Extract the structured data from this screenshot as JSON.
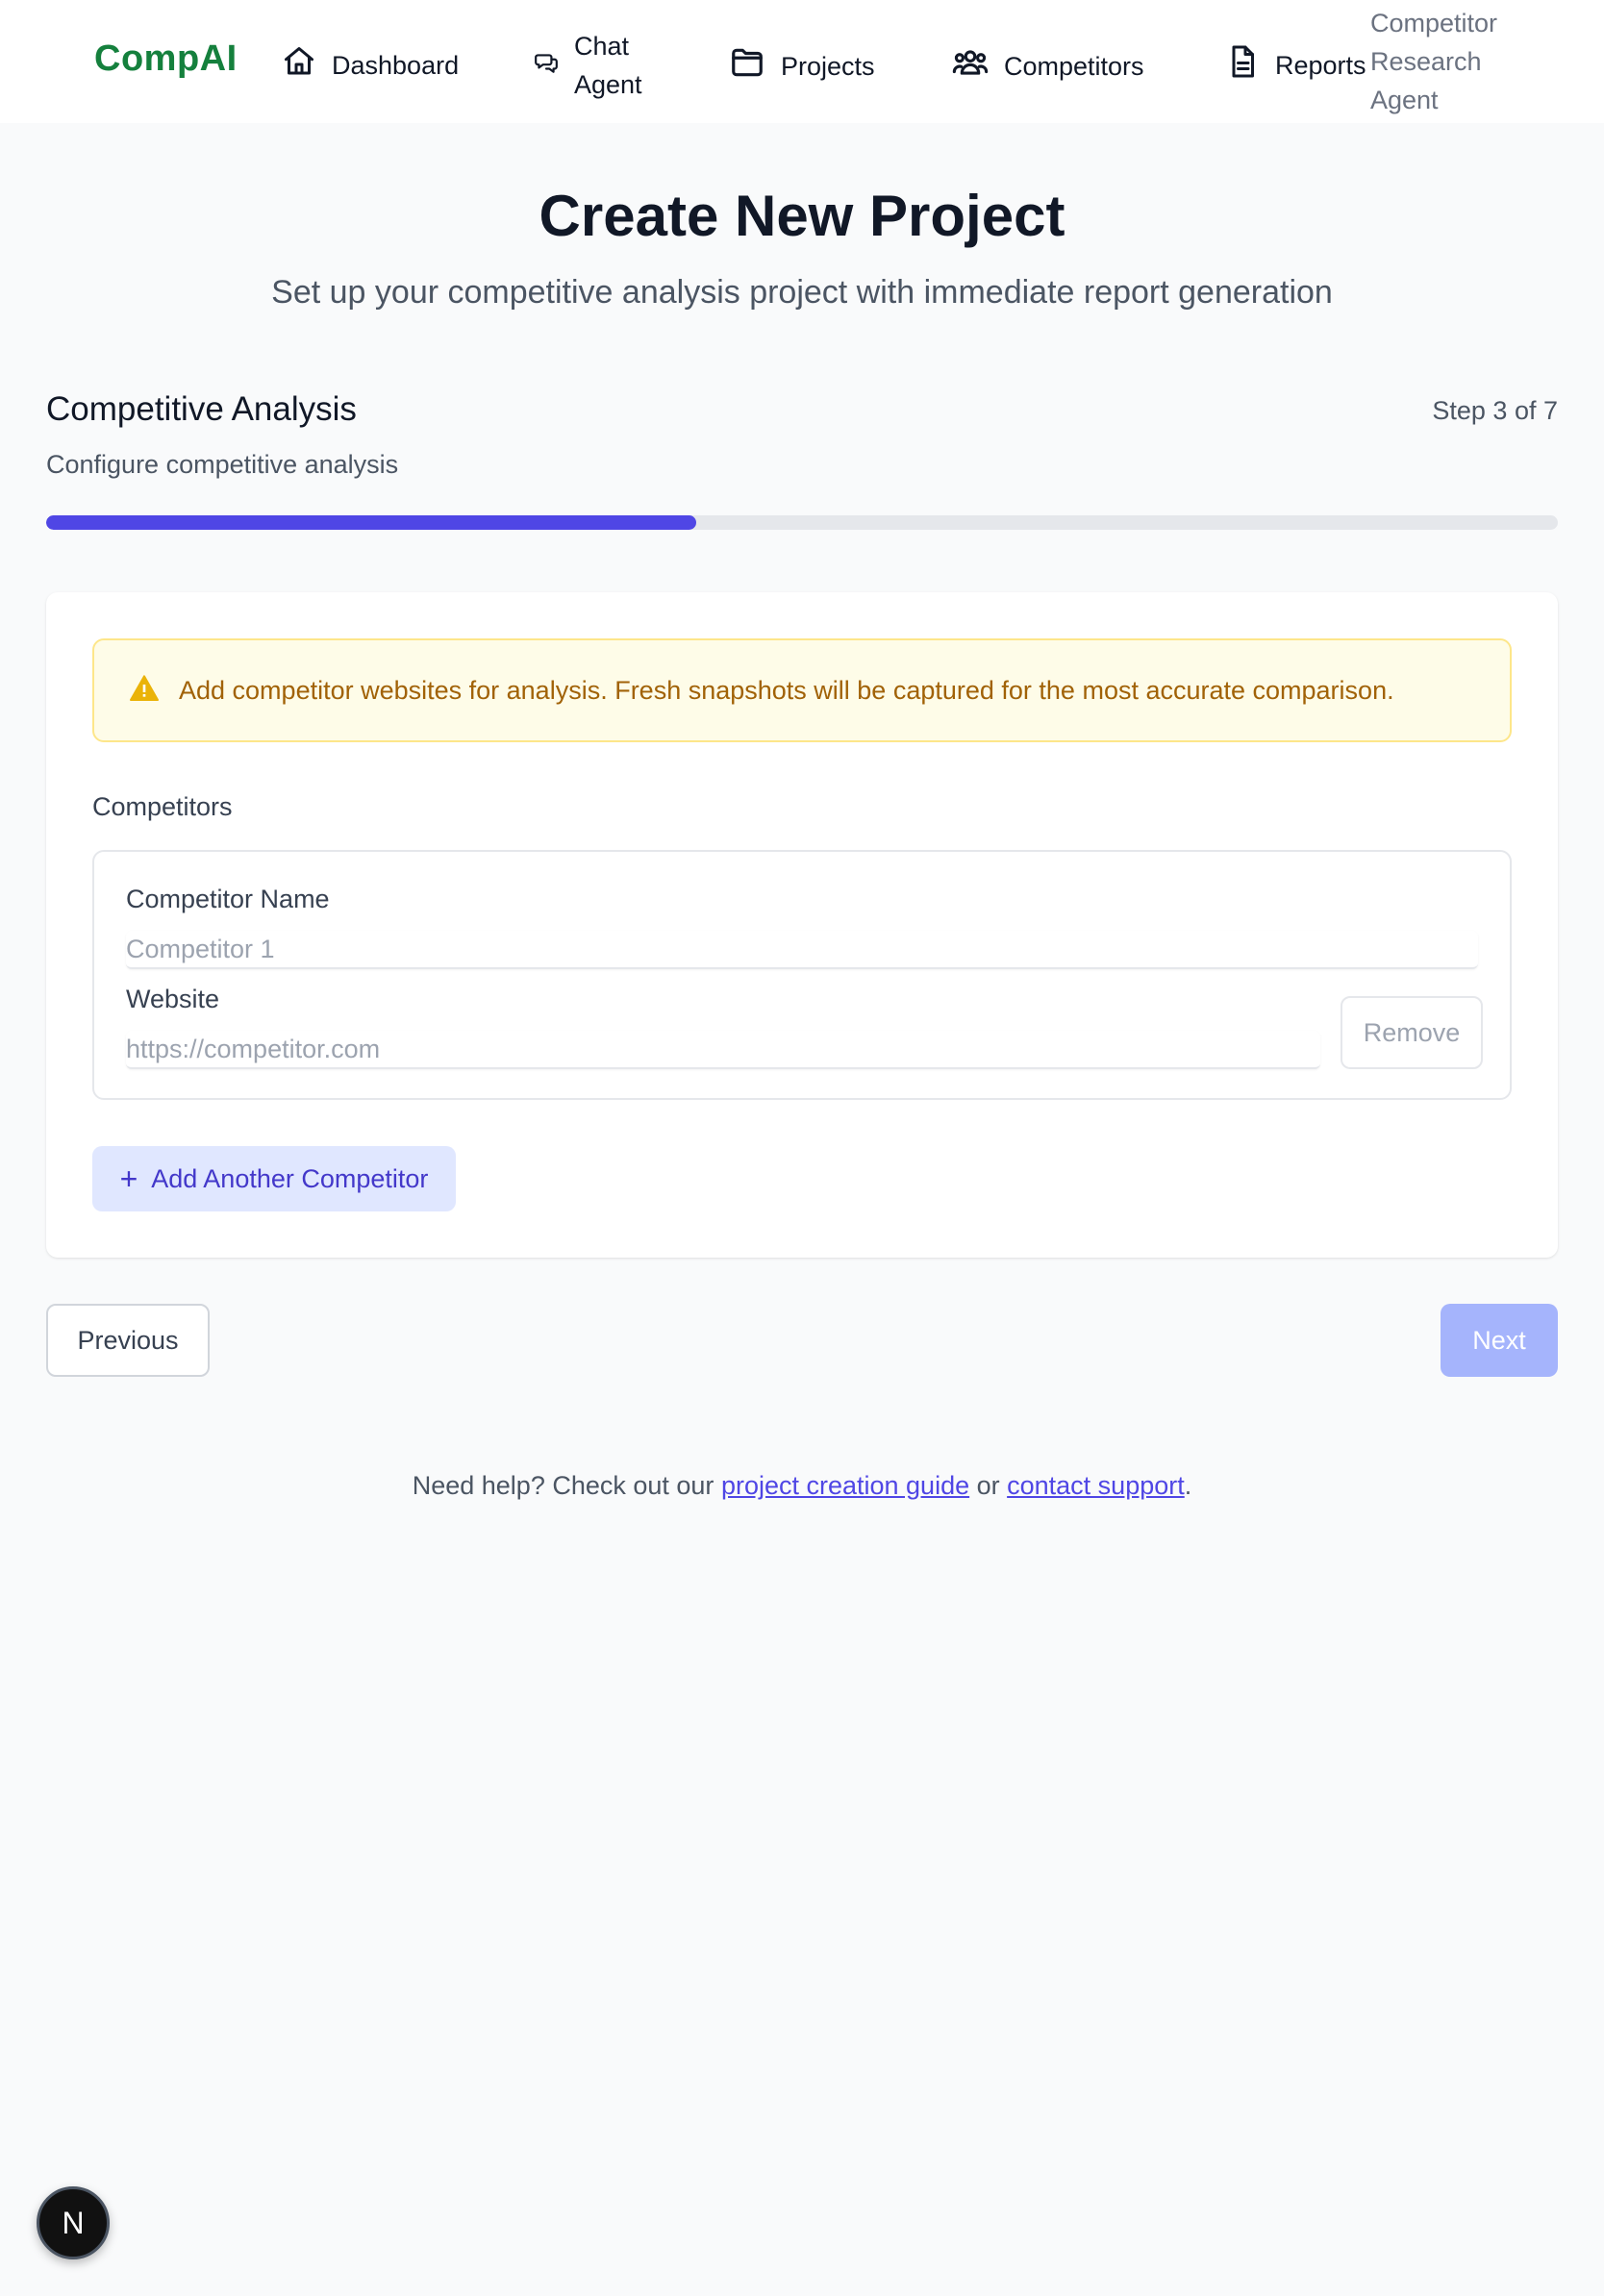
{
  "nav": {
    "brand": "CompAI",
    "items": [
      {
        "label": "Dashboard",
        "icon": "home-icon"
      },
      {
        "label": "Chat Agent",
        "icon": "chat-icon"
      },
      {
        "label": "Projects",
        "icon": "folder-icon"
      },
      {
        "label": "Competitors",
        "icon": "users-icon"
      },
      {
        "label": "Reports",
        "icon": "document-icon"
      }
    ],
    "right_label": "Competitor Research Agent"
  },
  "header": {
    "title": "Create New Project",
    "subtitle": "Set up your competitive analysis project with immediate report generation"
  },
  "step": {
    "title": "Competitive Analysis",
    "counter": "Step 3 of 7",
    "description": "Configure competitive analysis",
    "progress_fraction": 0.43
  },
  "alert": {
    "icon": "warning-icon",
    "text": "Add competitor websites for analysis. Fresh snapshots will be captured for the most accurate comparison."
  },
  "competitors": {
    "section_label": "Competitors",
    "entries": [
      {
        "name_label": "Competitor Name",
        "name_placeholder": "Competitor 1",
        "name_value": "",
        "website_label": "Website",
        "website_placeholder": "https://competitor.com",
        "website_value": "",
        "remove_label": "Remove"
      }
    ],
    "add_label": "Add Another Competitor"
  },
  "footer": {
    "previous_label": "Previous",
    "next_label": "Next",
    "help_prefix": "Need help? Check out our ",
    "help_link1": "project creation guide",
    "help_middle": " or ",
    "help_link2": "contact support",
    "help_suffix": "."
  },
  "fab": {
    "label": "N"
  },
  "colors": {
    "brand": "#15803d",
    "accent": "#4f46e5",
    "next_disabled": "#a5b4fc",
    "alert_bg": "#fefce8",
    "alert_text": "#a16207",
    "warning_icon": "#eab308"
  }
}
